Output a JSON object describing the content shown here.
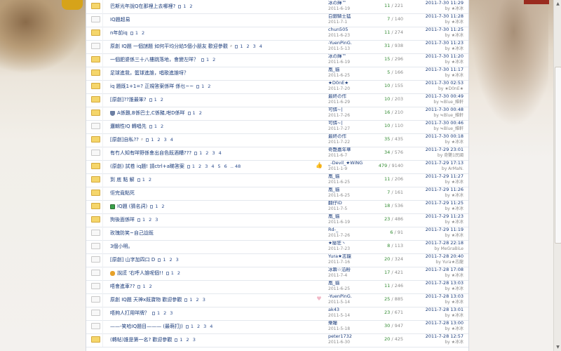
{
  "threads": [
    {
      "title": "巴斯光年說Q在那裡上去哪裡?",
      "pages": [
        "1",
        "2"
      ],
      "author": "冰の輝™",
      "date": "2011-6-19",
      "replies": "11",
      "views": "221",
      "last_time": "2011-7-30 11:29",
      "last_by": "by ★冰冰"
    },
    {
      "title": "IQ題超易",
      "pages": [],
      "author": "白銀騎士猛",
      "date": "2011-7-1",
      "replies": "7",
      "views": "140",
      "last_time": "2011-7-30 11:28",
      "last_by": "by ★冰冰"
    },
    {
      "title": "n年前iq",
      "pages": [
        "1",
        "2"
      ],
      "author": "chun505",
      "date": "2011-6-23",
      "replies": "11",
      "views": "274",
      "last_time": "2011-7-30 11:25",
      "last_by": "by ★冰冰"
    },
    {
      "title": "原創 IQ題 一個謎題 如何平均分給5個小朋友 歡迎參觀",
      "pages": [
        "1",
        "2",
        "3",
        "4"
      ],
      "author": "-YuenPinG.",
      "date": "2011-5-13",
      "replies": "31",
      "views": "938",
      "last_time": "2011-7-30 11:23",
      "last_by": "by ★冰冰"
    },
    {
      "title": "一個肥婆係三十八樓跳落地，會變左咩？",
      "pages": [
        "1",
        "2"
      ],
      "author": "冰の輝™",
      "date": "2011-6-19",
      "replies": "15",
      "views": "296",
      "last_time": "2011-7-30 11:20",
      "last_by": "by ★冰冰"
    },
    {
      "title": "足球進我，籃球進誰，唱歌進誰呀？",
      "pages": [],
      "author": "凰_貓",
      "date": "2011-6-25",
      "replies": "5",
      "views": "166",
      "last_time": "2011-7-30 11:17",
      "last_by": "by ★冰冰"
    },
    {
      "title": "iq 題既1+1=? 正規答案係咩 係乜~~",
      "pages": [
        "1",
        "2"
      ],
      "author": "★D0nE★",
      "date": "2011-7-20",
      "replies": "10",
      "views": "155",
      "last_time": "2011-7-30 02:53",
      "last_by": "by ★D0nE★"
    },
    {
      "title": "[原創]??誰最笨?",
      "pages": [
        "1",
        "2"
      ],
      "author": "最終の作",
      "date": "2011-6-29",
      "replies": "10",
      "views": "203",
      "last_time": "2011-7-30 00:49",
      "last_by": "by ≒Blue_維軒"
    },
    {
      "title": "A係雞,B係巴士,C係豬,咁D係咩",
      "pages": [
        "1",
        "2"
      ],
      "author": "可憐~|",
      "date": "2011-7-26",
      "replies": "16",
      "views": "210",
      "last_time": "2011-7-30 00:48",
      "last_by": "by ≒Blue_維軒"
    },
    {
      "title": "邏輯性IQ 轉唱先",
      "pages": [
        "1",
        "2"
      ],
      "author": "可憐~|",
      "date": "2011-7-27",
      "replies": "10",
      "views": "110",
      "last_time": "2011-7-30 00:46",
      "last_by": "by ≒Blue_維軒"
    },
    {
      "title": "[原創]自私??",
      "pages": [
        "1",
        "2",
        "3",
        "4"
      ],
      "author": "最終の作",
      "date": "2011-7-22",
      "replies": "35",
      "views": "435",
      "last_time": "2011-7-30 00:18",
      "last_by": "by ★冰冰"
    },
    {
      "title": "有冇人知有咩野係會出自色既酒糟???",
      "pages": [
        "1",
        "2",
        "3",
        "4"
      ],
      "author": "奇艷嘉年華",
      "date": "2011-6-7",
      "replies": "34",
      "views": "576",
      "last_time": "2011-7-29 23:01",
      "last_by": "by 奇艷1民國"
    },
    {
      "title": "(原創) 試卷 iq題! 請ctrl+a睇答案",
      "pages": [
        "1",
        "2",
        "3",
        "4",
        "5",
        "6",
        ".. 48"
      ],
      "author": "_-Devil_★WiNG",
      "date": "2011-1-9",
      "replies": "479",
      "views": "9140",
      "last_time": "2011-7-29 17:13",
      "last_by": "by ArMaN."
    },
    {
      "title": "到 底 點 解",
      "pages": [
        "1",
        "2"
      ],
      "author": "凰_貓",
      "date": "2011-6-25",
      "replies": "11",
      "views": "206",
      "last_time": "2011-7-29 11:27",
      "last_by": "by ★冰冰"
    },
    {
      "title": "佢完竟點死",
      "pages": [],
      "author": "凰_貓",
      "date": "2011-6-25",
      "replies": "7",
      "views": "161",
      "last_time": "2011-7-29 11:26",
      "last_by": "by ★冰冰"
    },
    {
      "title": "IQ題 (猜名詞)",
      "pages": [
        "1",
        "2"
      ],
      "author": "翻仔iD",
      "date": "2011-7-5",
      "replies": "18",
      "views": "536",
      "last_time": "2011-7-29 11:25",
      "last_by": "by ★冰冰"
    },
    {
      "title": "狗後面係咩",
      "pages": [
        "1",
        "2",
        "3"
      ],
      "author": "凰_貓",
      "date": "2011-6-19",
      "replies": "23",
      "views": "486",
      "last_time": "2011-7-29 11:23",
      "last_by": "by ★冰冰"
    },
    {
      "title": "玫瑰防笑~自己諗既",
      "pages": [],
      "author": "Rd-_",
      "date": "2011-7-26",
      "replies": "6",
      "views": "91",
      "last_time": "2011-7-29 11:19",
      "last_by": "by ★冰冰"
    },
    {
      "title": "3個小明。",
      "pages": [],
      "author": "★壓狂丶",
      "date": "2011-7-23",
      "replies": "8",
      "views": "113",
      "last_time": "2011-7-28 22:18",
      "last_by": "by MeGraBiLe"
    },
    {
      "title": "[原創] 山字加四口 D",
      "pages": [
        "1",
        "2",
        "3"
      ],
      "author": "Yura★志龍",
      "date": "2011-7-16",
      "replies": "20",
      "views": "324",
      "last_time": "2011-7-28 20:40",
      "last_by": "by Yura★志龍"
    },
    {
      "title": "說謊 '右呼人誰呢個!!",
      "pages": [
        "1",
        "2"
      ],
      "author": "冰瞬☆沿粉",
      "date": "2011-7-4",
      "replies": "17",
      "views": "421",
      "last_time": "2011-7-28 17:08",
      "last_by": "by ★冰冰"
    },
    {
      "title": "唔會進車??",
      "pages": [
        "1",
        "2"
      ],
      "author": "凰_貓",
      "date": "2011-6-25",
      "replies": "11",
      "views": "246",
      "last_time": "2011-7-28 13:03",
      "last_by": "by ★冰冰"
    },
    {
      "title": "原創 IQ題 天神x既寶物 歡迎參觀",
      "pages": [
        "1",
        "2",
        "3"
      ],
      "author": "-YuenPinG.",
      "date": "2011-5-14",
      "replies": "25",
      "views": "885",
      "last_time": "2011-7-28 13:03",
      "last_by": "by ★冰冰"
    },
    {
      "title": "唔夠人打用咩牌？",
      "pages": [
        "1",
        "2",
        "3"
      ],
      "author": "ak43",
      "date": "2011-5-14",
      "replies": "23",
      "views": "671",
      "last_time": "2011-7-28 13:01",
      "last_by": "by ★冰冰"
    },
    {
      "title": "——-笑哈IQ題目——— (最萌打J)",
      "pages": [
        "1",
        "2",
        "3",
        "4"
      ],
      "author": "樂瞳",
      "date": "2011-5-18",
      "replies": "30",
      "views": "947",
      "last_time": "2011-7-28 13:00",
      "last_by": "by ★冰冰"
    },
    {
      "title": "(轉帖)誰是第一名? 歡迎參觀",
      "pages": [
        "1",
        "2",
        "3"
      ],
      "author": "peter1732",
      "date": "2011-6-30",
      "replies": "20",
      "views": "425",
      "last_time": "2011-7-28 12:57",
      "last_by": "by ★冰冰"
    }
  ]
}
